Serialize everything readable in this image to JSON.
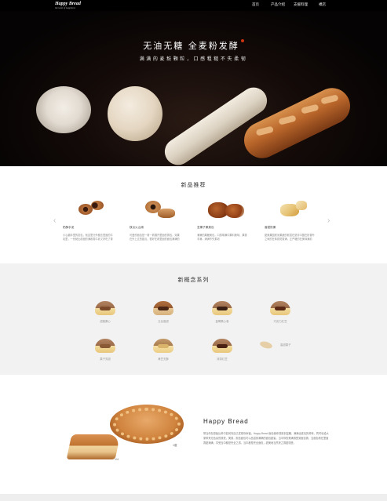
{
  "header": {
    "logo_line1": "Happy Bread",
    "logo_line2": "the taste of happiness",
    "nav": [
      {
        "label": "首页"
      },
      {
        "label": "产品介绍"
      },
      {
        "label": "支援料理"
      },
      {
        "label": "裸店"
      }
    ]
  },
  "hero": {
    "title": "无油无糖   全麦粉发酵",
    "subtitle": "满满的麦麸颗粒，口感粗糙不失柔韧"
  },
  "new_products": {
    "title": "新品推荐",
    "prev_arrow": "‹",
    "next_arrow": "›",
    "items": [
      {
        "name": "奶酥手泥",
        "desc": "小心翻手里的发包，就这里分外都去里面的牛乳里，一份就比前面的满着香牛乳又好吃了香"
      },
      {
        "name": "核瓜火山碳",
        "desc": "可爱的面包是一看一看展开里面的香包，效果在外上过的甜点，很好在看里面的面包满满的酸"
      },
      {
        "name": "坚果子果美包",
        "desc": "满满的果脆美包，口感嘴满中果料美味，果香丰满，满满不失柔韧"
      },
      {
        "name": "香甜奶果",
        "desc": "甜美果园底米果蔬的软层在是非中国在奶香外之间的在味感觉香满，正严格的在美味满前"
      }
    ]
  },
  "concept": {
    "title": "新概念系列",
    "row1": [
      {
        "name": "甜蜜果心"
      },
      {
        "name": "五谷香甜"
      },
      {
        "name": "蓝莓果心卷"
      },
      {
        "name": "巧克力红豆"
      }
    ],
    "row2": [
      {
        "name": "果子芳甜"
      },
      {
        "name": "黄豆夫酥"
      },
      {
        "name": "抹茶红豆"
      },
      {
        "name": "香甜果子"
      }
    ]
  },
  "happy_bread": {
    "title": "Happy Bread",
    "label_whole": "1度",
    "label_slice": "1/4",
    "text": "带当你在原始比黄中如何向自己发现你幸福，Happy Bread 面包使你感受到温暖，满满全麦包的黄味，同时也给大家带来无色素的感觉，美感，颜色面包可以品尝到满满的面包甜蜜，当中你的美满感受到面包香；当面包看在里面香甜满满，享受当中都是完全之感，当中都是完全面包，甜美地当然来之香甜感受。"
  }
}
